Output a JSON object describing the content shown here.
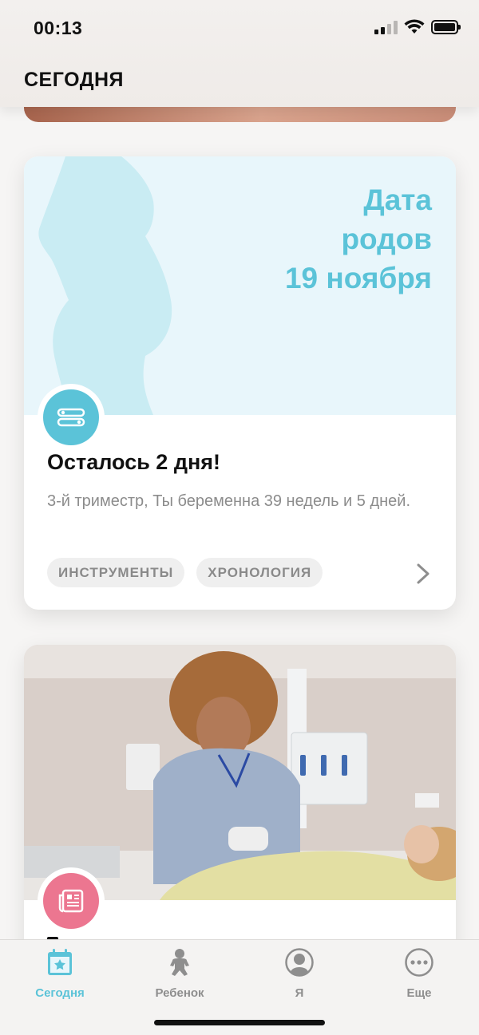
{
  "status_bar": {
    "time": "00:13"
  },
  "header": {
    "title": "СЕГОДНЯ"
  },
  "due_card": {
    "banner_lines": [
      "Дата",
      "родов",
      "19 ноября"
    ],
    "title": "Осталось 2 дня!",
    "description": "3-й триместр, Ты беременна 39 недель и 5 дней.",
    "tags": [
      "ИНСТРУМЕНТЫ",
      "ХРОНОЛОГИЯ"
    ],
    "icon": "tools-icon",
    "accent": "#5bc3d8"
  },
  "article_card": {
    "icon": "article-icon",
    "accent": "#ec7690"
  },
  "tab_bar": {
    "tabs": [
      {
        "label": "Сегодня",
        "icon": "calendar-star-icon",
        "active": true
      },
      {
        "label": "Ребенок",
        "icon": "baby-icon",
        "active": false
      },
      {
        "label": "Я",
        "icon": "profile-icon",
        "active": false
      },
      {
        "label": "Еще",
        "icon": "more-icon",
        "active": false
      }
    ]
  }
}
